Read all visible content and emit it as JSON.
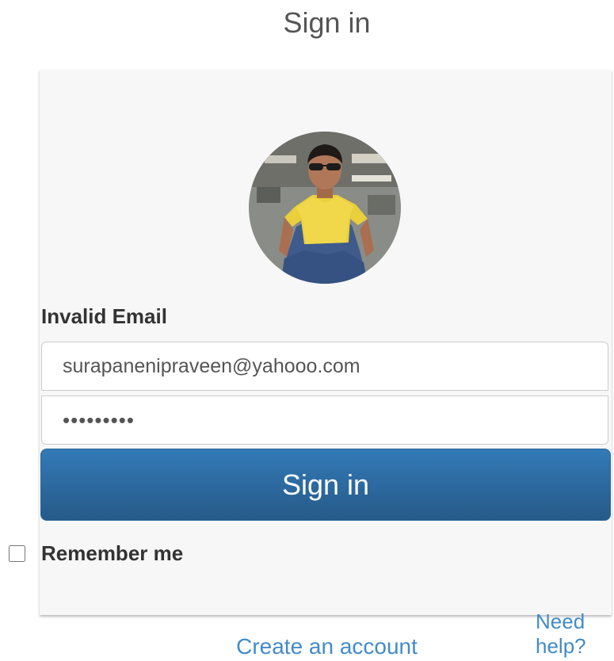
{
  "page": {
    "title": "Sign in"
  },
  "form": {
    "avatar_alt": "profile photo",
    "error_message": "Invalid Email",
    "email_value": "surapanenipraveen@yahooo.com",
    "password_display": "•••••••••",
    "submit_label": "Sign in",
    "remember_label": "Remember me",
    "remember_checked": false,
    "help_link": "Need help?"
  },
  "footer": {
    "create_account_link": "Create an account"
  },
  "colors": {
    "link": "#428bca",
    "button_top": "#337ab7",
    "button_bottom": "#265a88",
    "card_background": "#f7f7f7",
    "text": "#333333"
  }
}
